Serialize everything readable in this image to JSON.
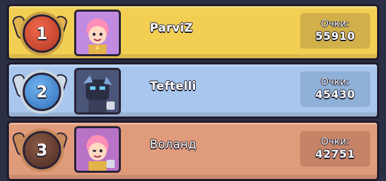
{
  "leaderboard": {
    "rows": [
      {
        "rank": "1",
        "name": "ParviZ",
        "score_label": "Очки:",
        "score": "55910",
        "row_color": "#f2cf53",
        "avatar_icon": "pink-haired-brawler-portrait"
      },
      {
        "rank": "2",
        "name": "Teftelli",
        "score_label": "Очки:",
        "score": "45430",
        "row_color": "#a9c7ee",
        "avatar_icon": "dark-robot-brawler-portrait"
      },
      {
        "rank": "3",
        "name": "Воланд",
        "score_label": "Очки:",
        "score": "42751",
        "row_color": "#e09b7b",
        "avatar_icon": "pink-haired-brawler-portrait"
      }
    ]
  }
}
